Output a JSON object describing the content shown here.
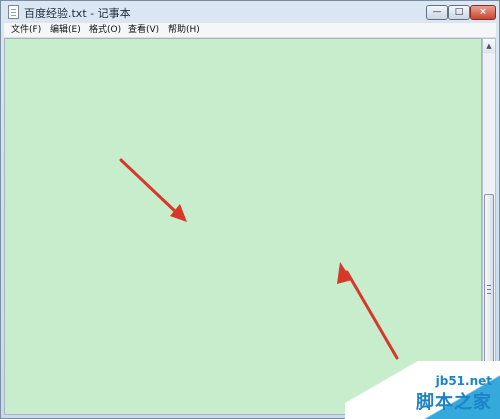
{
  "window": {
    "title": "百度经验.txt - 记事本",
    "controls": {
      "minimize": "—",
      "maximize": "□",
      "close": "×"
    }
  },
  "menu": {
    "items": [
      "文件(F)",
      "编辑(E)",
      "格式(O)",
      "查看(V)",
      "帮助(H)"
    ]
  },
  "editor": {
    "background_color": "#C7EDCC",
    "content": ""
  },
  "scrollbar": {
    "up_icon": "scroll-up-arrow-icon",
    "down_icon": "scroll-down-arrow-icon"
  },
  "annotations": {
    "arrow_color": "#D6382A"
  },
  "watermark": {
    "site": "jb51.net",
    "brand": "脚本之家"
  }
}
